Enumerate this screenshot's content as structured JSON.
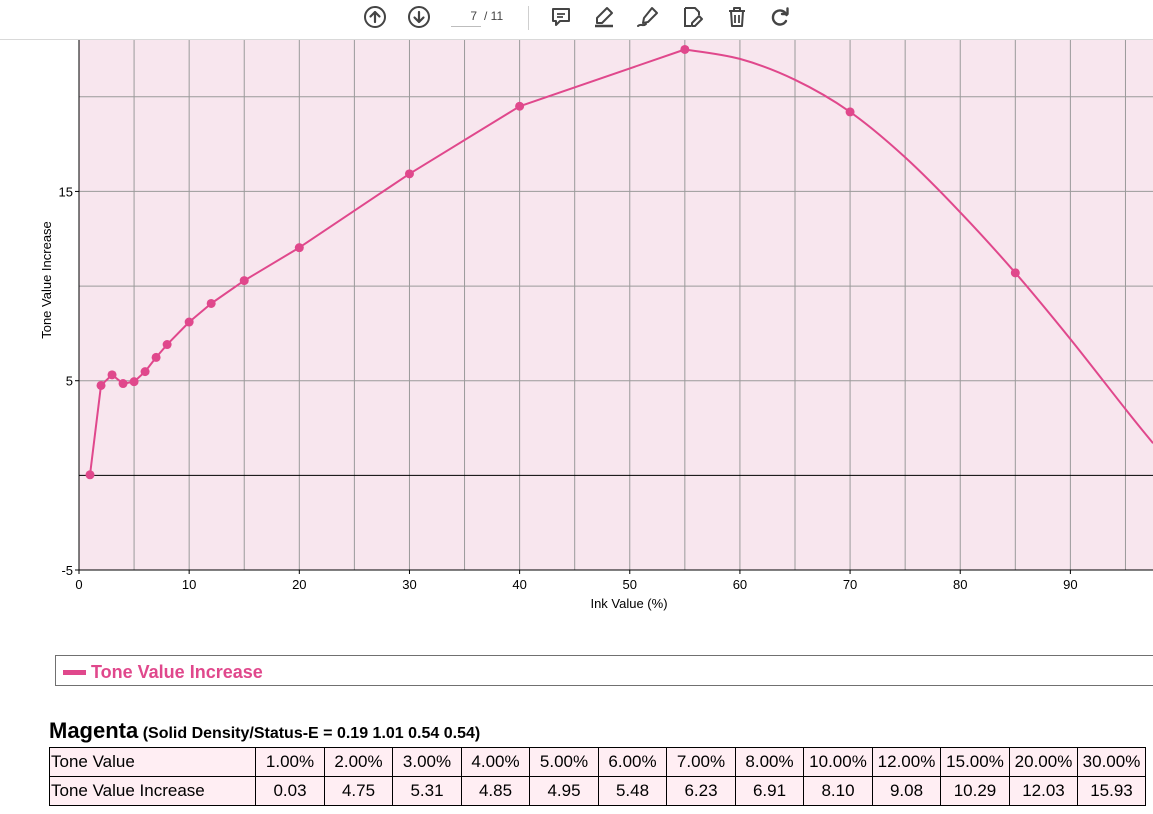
{
  "toolbar": {
    "page_current": "7",
    "page_total": "/ 11",
    "icons": [
      "arrow-up-circle-icon",
      "arrow-down-circle-icon",
      "comment-icon",
      "highlight-pen-icon",
      "draw-pen-icon",
      "edit-document-icon",
      "trash-icon",
      "redo-icon"
    ]
  },
  "chart_data": {
    "type": "line",
    "title": "",
    "xlabel": "Ink Value (%)",
    "ylabel": "Tone Value Increase",
    "xlim": [
      0,
      97.5
    ],
    "ylim": [
      -5,
      23
    ],
    "xticks": [
      0,
      10,
      20,
      30,
      40,
      50,
      60,
      70,
      80,
      90
    ],
    "yticks": [
      -5,
      5,
      15
    ],
    "grid": true,
    "legend_position": "bottom",
    "series": [
      {
        "name": "Tone Value Increase",
        "color": "#e0488c",
        "points": [
          [
            1,
            0.03
          ],
          [
            2,
            4.75
          ],
          [
            3,
            5.31
          ],
          [
            4,
            4.85
          ],
          [
            5,
            4.95
          ],
          [
            6,
            5.48
          ],
          [
            7,
            6.23
          ],
          [
            8,
            6.91
          ],
          [
            10,
            8.1
          ],
          [
            12,
            9.08
          ],
          [
            15,
            10.29
          ],
          [
            20,
            12.03
          ],
          [
            30,
            15.93
          ],
          [
            40,
            19.5
          ],
          [
            55,
            22.5
          ],
          [
            70,
            19.2
          ],
          [
            85,
            10.7
          ]
        ],
        "curve": [
          [
            55,
            22.5
          ],
          [
            60,
            22.0
          ],
          [
            65,
            20.9
          ],
          [
            70,
            19.2
          ],
          [
            75,
            16.8
          ],
          [
            80,
            13.9
          ],
          [
            85,
            10.7
          ],
          [
            90,
            7.2
          ],
          [
            95,
            3.5
          ],
          [
            97.5,
            1.7
          ]
        ]
      }
    ]
  },
  "legend": {
    "label": "Tone Value Increase",
    "color": "#e0488c"
  },
  "section": {
    "title": "Magenta",
    "subtitle": "(Solid Density/Status-E = 0.19 1.01 0.54 0.54)"
  },
  "table": {
    "rows": [
      {
        "label": "Tone Value",
        "values": [
          "1.00%",
          "2.00%",
          "3.00%",
          "4.00%",
          "5.00%",
          "6.00%",
          "7.00%",
          "8.00%",
          "10.00%",
          "12.00%",
          "15.00%",
          "20.00%",
          "30.00%"
        ]
      },
      {
        "label": "Tone Value Increase",
        "values": [
          "0.03",
          "4.75",
          "5.31",
          "4.85",
          "4.95",
          "5.48",
          "6.23",
          "6.91",
          "8.10",
          "9.08",
          "10.29",
          "12.03",
          "15.93"
        ]
      }
    ]
  }
}
